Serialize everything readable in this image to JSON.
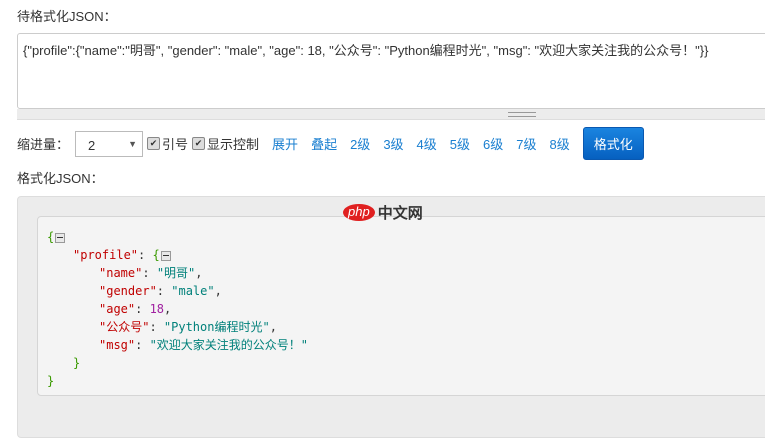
{
  "input": {
    "label": "待格式化JSON：",
    "value": "{\"profile\":{\"name\":\"明哥\", \"gender\": \"male\", \"age\": 18, \"公众号\": \"Python编程时光\", \"msg\": \"欢迎大家关注我的公众号！\"}}"
  },
  "controls": {
    "indent_label": "缩进量：",
    "indent_value": "2",
    "quote_label": "引号",
    "show_ctrl_label": "显示控制",
    "expand": "展开",
    "collapse": "叠起",
    "levels": [
      "2级",
      "3级",
      "4级",
      "5级",
      "6级",
      "7级",
      "8级"
    ],
    "format_button": "格式化"
  },
  "output": {
    "label": "格式化JSON：",
    "watermark": {
      "php": "php",
      "text": "中文网"
    },
    "lines": [
      {
        "indent": 0,
        "open": "{"
      },
      {
        "indent": 1,
        "key": "\"profile\"",
        "open": "{"
      },
      {
        "indent": 2,
        "key": "\"name\"",
        "str": "\"明哥\"",
        "comma": ","
      },
      {
        "indent": 2,
        "key": "\"gender\"",
        "str": "\"male\"",
        "comma": ","
      },
      {
        "indent": 2,
        "key": "\"age\"",
        "num": "18",
        "comma": ","
      },
      {
        "indent": 2,
        "key": "\"公众号\"",
        "str": "\"Python编程时光\"",
        "comma": ","
      },
      {
        "indent": 2,
        "key": "\"msg\"",
        "str": "\"欢迎大家关注我的公众号！\""
      },
      {
        "indent": 1,
        "close": "}"
      },
      {
        "indent": 0,
        "close": "}"
      }
    ]
  },
  "colors": {
    "key": "#c00000",
    "string": "#00807a",
    "number": "#a020a0",
    "brace": "#3a9a00",
    "link": "#1a7fd0",
    "button": "#0660c0"
  }
}
